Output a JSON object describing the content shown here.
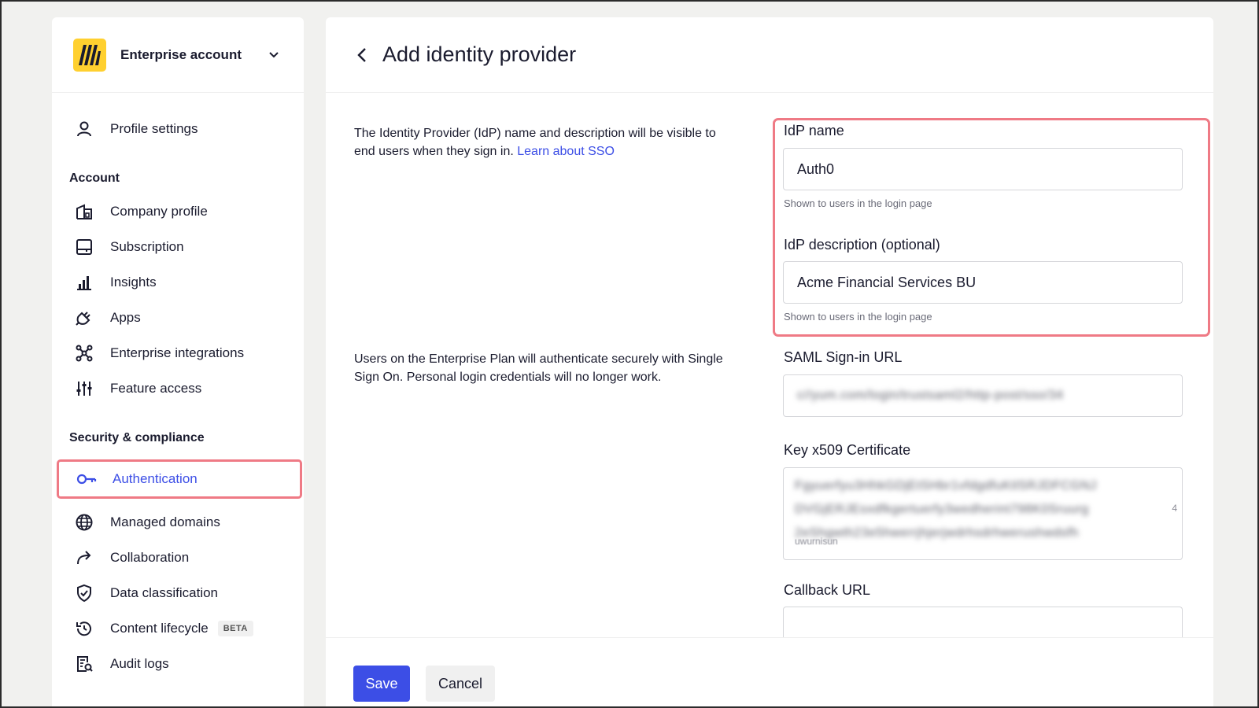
{
  "account": {
    "name": "Enterprise account"
  },
  "sidebar": {
    "profile": "Profile settings",
    "section_account": "Account",
    "account_items": [
      "Company profile",
      "Subscription",
      "Insights",
      "Apps",
      "Enterprise integrations",
      "Feature access"
    ],
    "section_security": "Security & compliance",
    "security_items": [
      "Authentication",
      "Managed domains",
      "Collaboration",
      "Data classification",
      "Content lifecycle",
      "Audit logs"
    ],
    "beta_badge": "BETA"
  },
  "page": {
    "title": "Add identity provider",
    "desc1": "The Identity Provider (IdP) name and description will be visible to end users when they sign in.",
    "desc1_link": "Learn about SSO",
    "desc2": "Users on the Enterprise Plan will authenticate securely with Single Sign On. Personal login credentials will no longer work."
  },
  "form": {
    "idp_name_label": "IdP name",
    "idp_name_value": "Auth0",
    "idp_name_helper": "Shown to users in the login page",
    "idp_desc_label": "IdP description (optional)",
    "idp_desc_value": "Acme Financial Services BU",
    "idp_desc_helper": "Shown to users in the login page",
    "saml_label": "SAML Sign-in URL",
    "saml_value": "c//yum.com/login/trustsaml2/http-post/sso/34",
    "cert_label": "Key x509 Certificate",
    "cert_lines": [
      "Fgyuerfyu3HhkGDjEtSHbr1vfdgdfuKtlSRJDFCGNJ",
      "DVGjERJEsxdfkgertuerfy3wedherint798K0Sruurg",
      "2eShgwth23e5hwerrjhjerjwdrhsdrhwerushwdsfh"
    ],
    "cert_tail": "uwurnisun",
    "cert_scroll": "4",
    "callback_label": "Callback URL"
  },
  "footer": {
    "save": "Save",
    "cancel": "Cancel"
  },
  "colors": {
    "accent": "#3c4ee6",
    "highlight": "#ef7a85",
    "logo_bg": "#ffd02f"
  }
}
